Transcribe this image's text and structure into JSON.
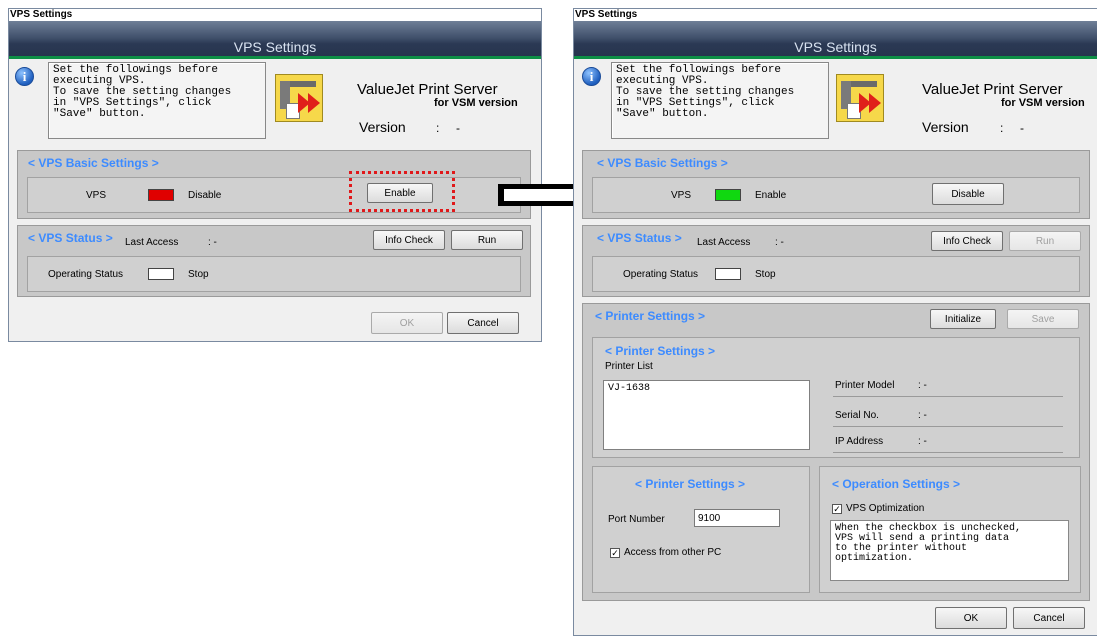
{
  "left_window": {
    "title": "VPS Settings",
    "banner": "VPS Settings",
    "message": "Set the followings before\nexecuting VPS.\nTo save the setting changes\nin \"VPS Settings\", click\n\"Save\" button.",
    "product": "ValueJet Print Server",
    "product_sub": "for VSM version",
    "version_label": "Version",
    "version_sep": ":",
    "version_value": "-",
    "basic": {
      "header": "< VPS Basic Settings >",
      "vps_label": "VPS",
      "status_text": "Disable",
      "indicator_color": "#e00000",
      "button": "Enable"
    },
    "status": {
      "header": "< VPS Status >",
      "last_access_label": "Last Access",
      "last_access_value": ":  -",
      "info_check": "Info Check",
      "run": "Run",
      "operating_label": "Operating Status",
      "operating_value": "Stop"
    },
    "ok": "OK",
    "cancel": "Cancel"
  },
  "right_window": {
    "title": "VPS Settings",
    "banner": "VPS Settings",
    "message": "Set the followings before\nexecuting VPS.\nTo save the setting changes\nin \"VPS Settings\", click\n\"Save\" button.",
    "product": "ValueJet Print Server",
    "product_sub": "for VSM version",
    "version_label": "Version",
    "version_sep": ":",
    "version_value": "-",
    "basic": {
      "header": "< VPS Basic Settings >",
      "vps_label": "VPS",
      "status_text": "Enable",
      "indicator_color": "#10d810",
      "button": "Disable"
    },
    "status": {
      "header": "< VPS Status >",
      "last_access_label": "Last Access",
      "last_access_value": ":  -",
      "info_check": "Info Check",
      "run": "Run",
      "operating_label": "Operating Status",
      "operating_value": "Stop"
    },
    "printer": {
      "header": "< Printer Settings >",
      "initialize": "Initialize",
      "save": "Save",
      "sub_header": "< Printer Settings >",
      "list_label": "Printer List",
      "list_items": [
        "VJ-1638"
      ],
      "model_label": "Printer Model",
      "model_value": ":  -",
      "serial_label": "Serial No.",
      "serial_value": ":  -",
      "ip_label": "IP Address",
      "ip_value": ":  -"
    },
    "port": {
      "header": "< Printer Settings >",
      "port_label": "Port Number",
      "port_value": "9100",
      "access_label": "Access from other PC",
      "access_checked": "✓"
    },
    "operation": {
      "header": "< Operation Settings >",
      "opt_label": "VPS Optimization",
      "opt_checked": "✓",
      "description": "When the checkbox is unchecked,\nVPS will send a printing data\nto the printer without\noptimization."
    },
    "ok": "OK",
    "cancel": "Cancel"
  }
}
